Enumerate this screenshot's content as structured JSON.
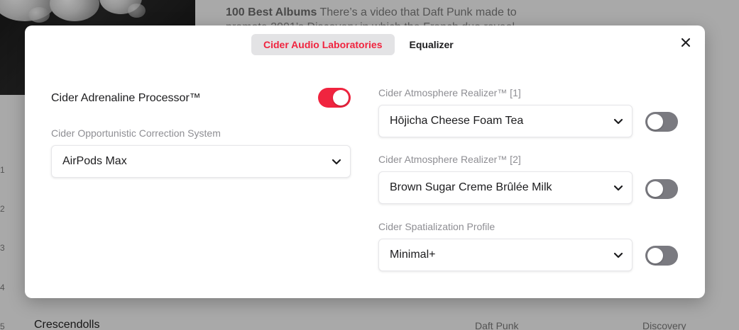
{
  "background": {
    "description_bold": "100 Best Albums",
    "description_text": " There’s a video that Daft Punk made to",
    "description_cut": "promote 2001’s Discovery in which the French duo reveal",
    "track_numbers": [
      "1",
      "2",
      "3",
      "4",
      "5"
    ],
    "visible_row": {
      "title": "Crescendolls",
      "artist": "Daft Punk",
      "album": "Discovery"
    }
  },
  "modal": {
    "tabs": [
      {
        "label": "Cider Audio Laboratories",
        "active": true
      },
      {
        "label": "Equalizer",
        "active": false
      }
    ],
    "close_icon": "close-icon",
    "left": {
      "adrenaline": {
        "label": "Cider Adrenaline Processor™",
        "enabled": true
      },
      "correction": {
        "label": "Cider Opportunistic Correction System",
        "value": "AirPods Max"
      }
    },
    "right": [
      {
        "label": "Cider Atmosphere Realizer™ [1]",
        "value": "Hōjicha Cheese Foam Tea",
        "enabled": false
      },
      {
        "label": "Cider Atmosphere Realizer™ [2]",
        "value": "Brown Sugar Creme Brûlée Milk",
        "enabled": false
      },
      {
        "label": "Cider Spatialization Profile",
        "value": "Minimal+",
        "enabled": false
      }
    ]
  },
  "colors": {
    "accent": "#f0243f",
    "toggle_off": "#7a7a80",
    "active_tab_bg": "#e3e3e5"
  }
}
